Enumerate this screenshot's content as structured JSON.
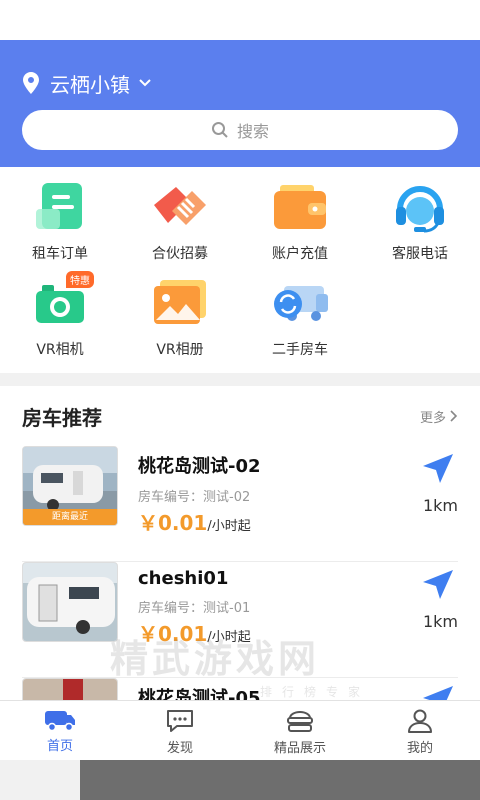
{
  "header": {
    "location": "云栖小镇",
    "search_placeholder": "搜索"
  },
  "grid": [
    {
      "label": "租车订单",
      "icon": "order-doc-icon"
    },
    {
      "label": "合伙招募",
      "icon": "handshake-icon"
    },
    {
      "label": "账户充值",
      "icon": "wallet-icon"
    },
    {
      "label": "客服电话",
      "icon": "headset-icon"
    },
    {
      "label": "VR相机",
      "icon": "camera-icon",
      "badge": "特惠"
    },
    {
      "label": "VR相册",
      "icon": "photo-album-icon"
    },
    {
      "label": "二手房车",
      "icon": "used-rv-icon"
    }
  ],
  "recommend": {
    "title": "房车推荐",
    "more": "更多",
    "items": [
      {
        "name": "桃花岛测试-02",
        "code": "房车编号：测试-02",
        "price": "￥0.01",
        "unit": "/小时起",
        "distance": "1km",
        "tag": "距离最近"
      },
      {
        "name": "cheshi01",
        "code": "房车编号：测试-01",
        "price": "￥0.01",
        "unit": "/小时起",
        "distance": "1km"
      },
      {
        "name": "桃花岛测试-05"
      }
    ]
  },
  "watermark": {
    "main": "精武游戏网",
    "sub": "排行榜专家"
  },
  "tabs": [
    {
      "label": "首页",
      "icon": "rv-home-icon",
      "active": true
    },
    {
      "label": "发现",
      "icon": "chat-bubble-icon"
    },
    {
      "label": "精品展示",
      "icon": "showcase-icon"
    },
    {
      "label": "我的",
      "icon": "user-icon"
    }
  ],
  "colors": {
    "primary": "#5b7fee",
    "accent": "#f39a2b",
    "tab_active": "#3f6fe8"
  }
}
